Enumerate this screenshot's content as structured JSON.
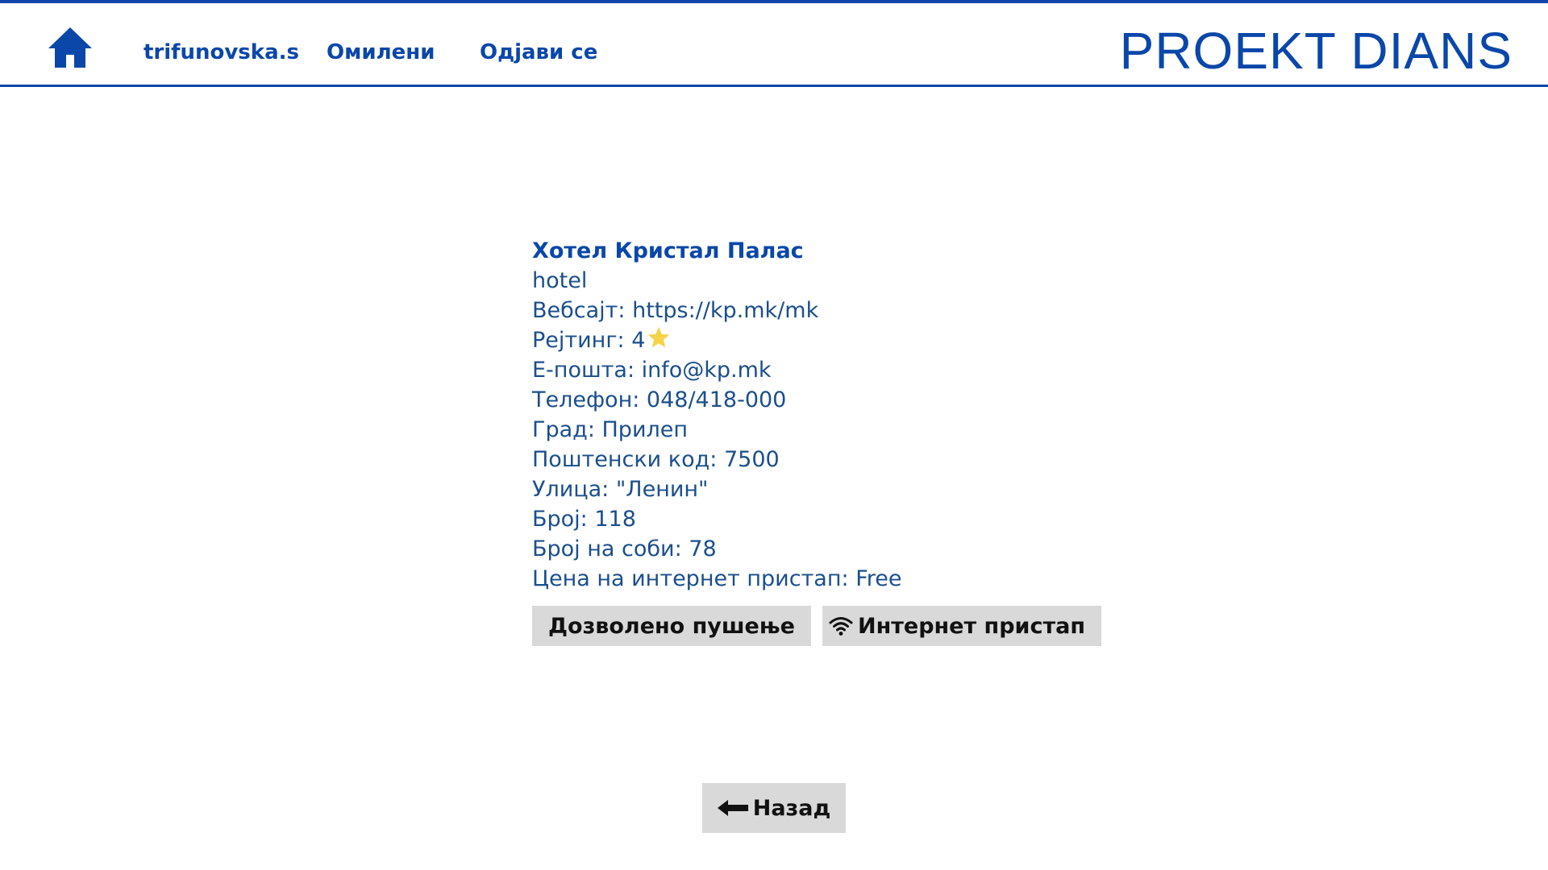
{
  "header": {
    "home_icon": "home-icon",
    "nav": {
      "username": "trifunovska.s",
      "favorites": "Омилени",
      "logout": "Одјави се"
    },
    "brand": "PROEKT DIANS",
    "accent_color": "#0a47a9"
  },
  "hotel": {
    "name": "Хотел Кристал Палас",
    "type": "hotel",
    "website_label": "Вебсајт: ",
    "website": "https://kp.mk/mk",
    "rating_label": "Рејтинг: ",
    "rating": "4",
    "rating_icon": "star-icon",
    "email_label": "Е-пошта: ",
    "email": "info@kp.mk",
    "phone_label": "Телефон: ",
    "phone": "048/418-000",
    "city_label": "Град: ",
    "city": "Прилеп",
    "postal_label": "Поштенски код: ",
    "postal_code": "7500",
    "street_label": "Улица: ",
    "street": "\"Ленин\"",
    "number_label": "Број: ",
    "number": "118",
    "rooms_label": "Број на соби: ",
    "rooms": "78",
    "internet_price_label": "Цена на интернет пристап: ",
    "internet_price": "Free"
  },
  "amenities": {
    "smoking": "Дозволено пушење",
    "internet": "Интернет пристап",
    "internet_icon": "wifi-icon"
  },
  "back_button": {
    "label": "Назад",
    "icon": "arrow-left-icon"
  }
}
